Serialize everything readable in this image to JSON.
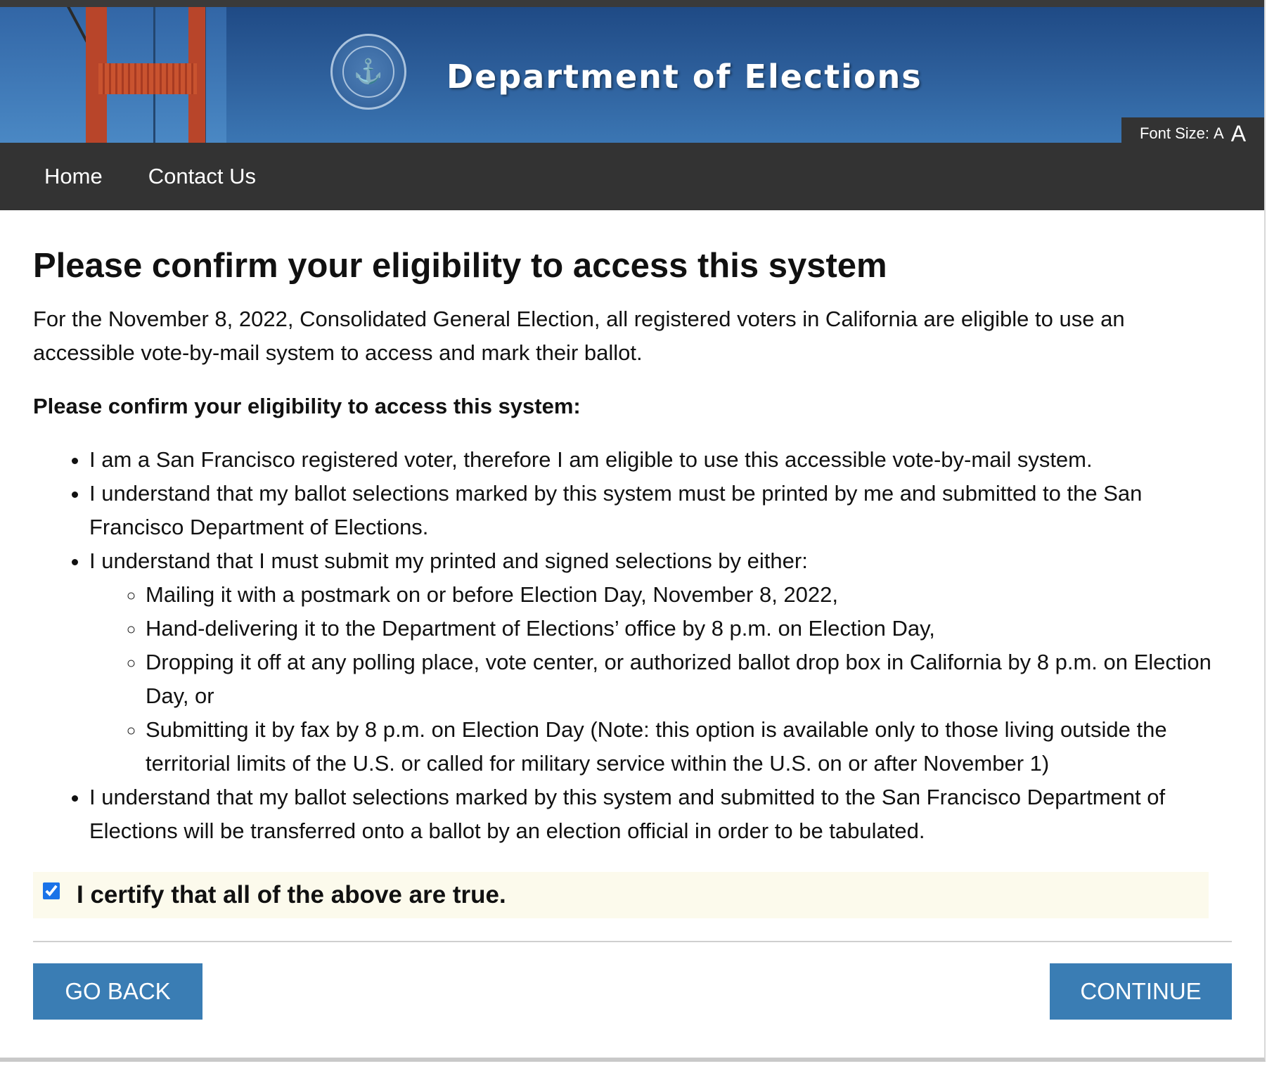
{
  "header": {
    "site_title": "Department of Elections",
    "seal_icon": "city-seal-icon",
    "font_size_label": "Font Size:",
    "font_small": "A",
    "font_large": "A"
  },
  "nav": {
    "home": "Home",
    "contact": "Contact Us"
  },
  "main": {
    "title": "Please confirm your eligibility to access this system",
    "intro": "For the November 8, 2022, Consolidated General Election, all registered voters in California are eligible to use an accessible vote-by-mail system to access and mark their ballot.",
    "confirm_heading": "Please confirm your eligibility to access this system:",
    "items": [
      "I am a San Francisco registered voter, therefore I am eligible to use this accessible vote-by-mail system.",
      "I understand that my ballot selections marked by this system must be printed by me and submitted to the San Francisco Department of Elections.",
      "I understand that I must submit my printed and signed selections by either:",
      "I understand that my ballot selections marked by this system and submitted to the San Francisco Department of Elections will be transferred onto a ballot by an election official in order to be tabulated."
    ],
    "sub_items": [
      "Mailing it with a postmark on or before Election Day, November 8, 2022,",
      "Hand-delivering it to the Department of Elections’ office by 8 p.m. on Election Day,",
      "Dropping it off at any polling place, vote center, or authorized ballot drop box in California by 8 p.m. on Election Day, or",
      "Submitting it by fax by 8 p.m. on Election Day (Note: this option is available only to those living outside the territorial limits of the U.S. or called for military service within the U.S. on or after November 1)"
    ],
    "certify_label": "I certify that all of the above are true.",
    "certify_checked": true
  },
  "buttons": {
    "back": "GO BACK",
    "continue": "CONTINUE"
  },
  "colors": {
    "nav_bg": "#333333",
    "button_bg": "#3a7db4",
    "certify_bg": "#fcfaec"
  }
}
